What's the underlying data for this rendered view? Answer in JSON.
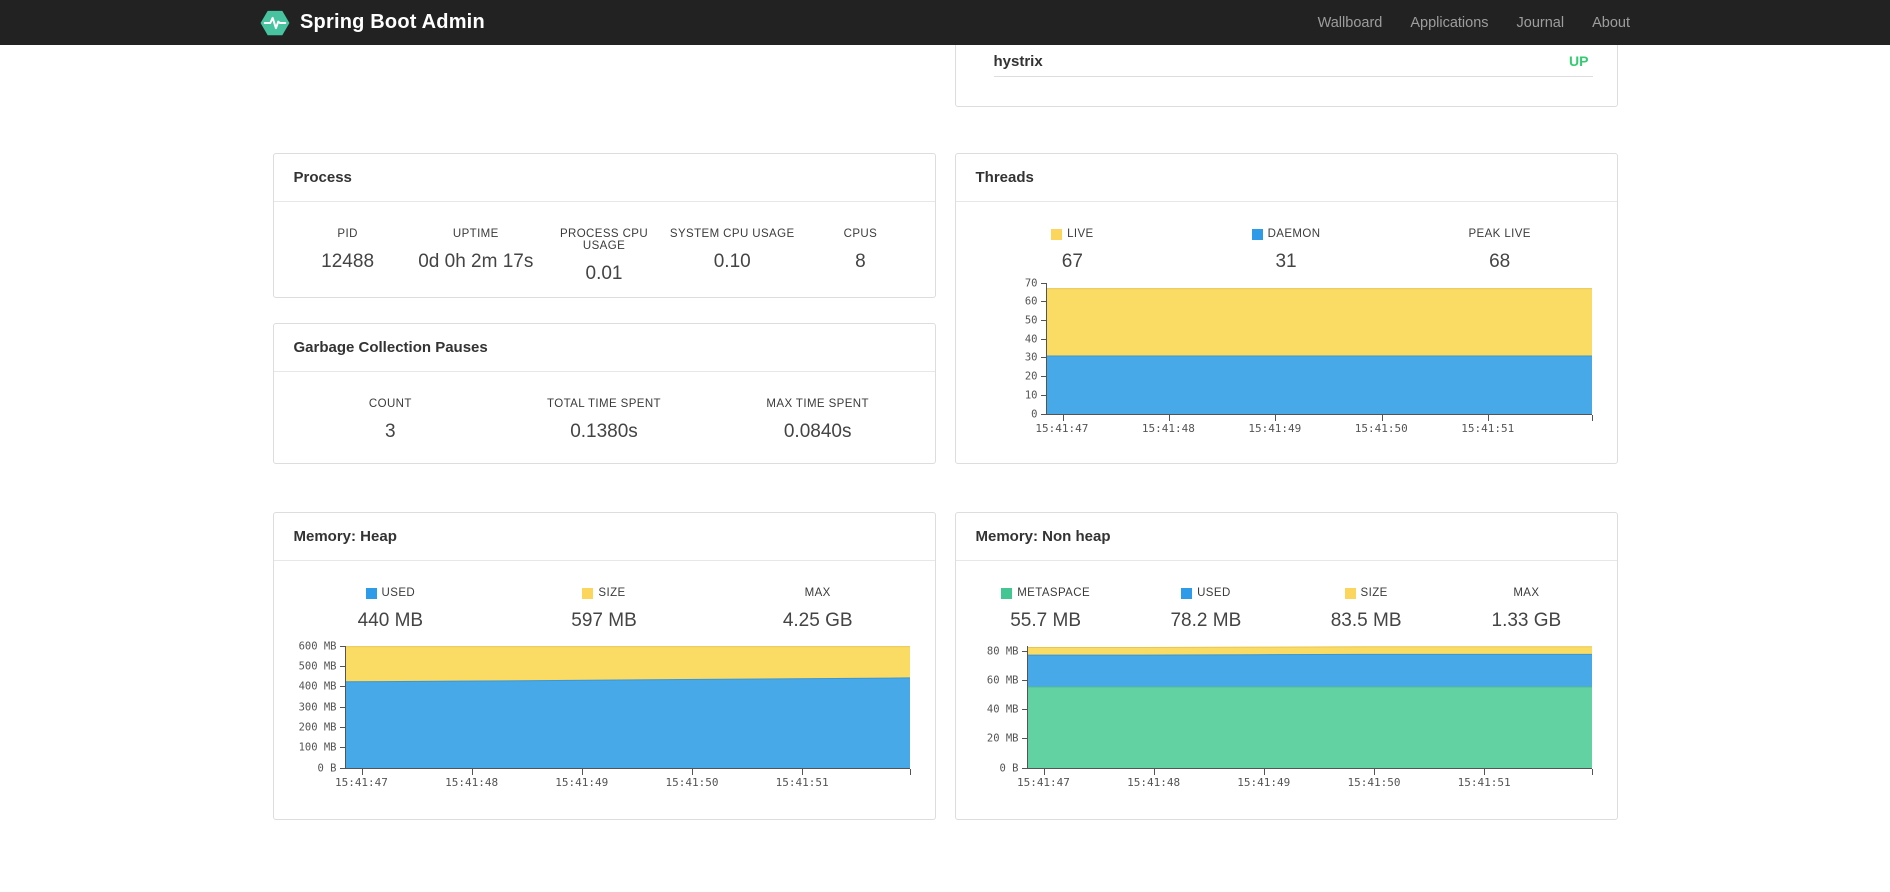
{
  "colors": {
    "brand-green": "#47c3a0",
    "navbar-bg": "#222222",
    "navbar-link": "#9d9d9d",
    "status-up-green": "#32cd70",
    "card-border": "#dddddd",
    "axis": "#545454",
    "chart-yellow": "#fadb63",
    "chart-blue": "#47a9e8",
    "chart-green": "#62d2a3"
  },
  "navbar": {
    "brand": "Spring Boot Admin",
    "logo_icon": "pulse-hexagon-icon",
    "links": [
      {
        "label": "Wallboard"
      },
      {
        "label": "Applications"
      },
      {
        "label": "Journal"
      },
      {
        "label": "About"
      }
    ]
  },
  "status_card": {
    "application": "hystrix",
    "status": "UP"
  },
  "cards": {
    "process": {
      "title": "Process",
      "metrics": [
        {
          "label": "PID",
          "value": "12488"
        },
        {
          "label": "UPTIME",
          "value": "0d 0h 2m 17s"
        },
        {
          "label": "PROCESS CPU USAGE",
          "value": "0.01"
        },
        {
          "label": "SYSTEM CPU USAGE",
          "value": "0.10"
        },
        {
          "label": "CPUS",
          "value": "8"
        }
      ]
    },
    "gc": {
      "title": "Garbage Collection Pauses",
      "metrics": [
        {
          "label": "COUNT",
          "value": "3"
        },
        {
          "label": "TOTAL TIME SPENT",
          "value": "0.1380s"
        },
        {
          "label": "MAX TIME SPENT",
          "value": "0.0840s"
        }
      ]
    },
    "threads": {
      "title": "Threads",
      "metrics": [
        {
          "label": "LIVE",
          "value": "67",
          "swatch": "#fbd55c"
        },
        {
          "label": "DAEMON",
          "value": "31",
          "swatch": "#2d9be8"
        },
        {
          "label": "PEAK LIVE",
          "value": "68"
        }
      ]
    },
    "heap": {
      "title": "Memory: Heap",
      "metrics": [
        {
          "label": "USED",
          "value": "440 MB",
          "swatch": "#2d9be8"
        },
        {
          "label": "SIZE",
          "value": "597 MB",
          "swatch": "#fbd55c"
        },
        {
          "label": "MAX",
          "value": "4.25 GB"
        }
      ]
    },
    "nonheap": {
      "title": "Memory: Non heap",
      "metrics": [
        {
          "label": "METASPACE",
          "value": "55.7 MB",
          "swatch": "#43c692"
        },
        {
          "label": "USED",
          "value": "78.2 MB",
          "swatch": "#2d9be8"
        },
        {
          "label": "SIZE",
          "value": "83.5 MB",
          "swatch": "#fbd55c"
        },
        {
          "label": "MAX",
          "value": "1.33 GB"
        }
      ]
    }
  },
  "chart_data": [
    {
      "type": "area",
      "title": "Threads",
      "xlabel": "",
      "ylabel": "",
      "grid": false,
      "legend_position": "top",
      "x": [
        "15:41:47",
        "15:41:48",
        "15:41:49",
        "15:41:50",
        "15:41:51"
      ],
      "x_start": 0.03,
      "x_step": 0.195,
      "extra_x_ticks": [
        1.0
      ],
      "ylim": [
        0,
        70
      ],
      "yticks": [
        {
          "v": 0,
          "label": "0"
        },
        {
          "v": 10,
          "label": "10"
        },
        {
          "v": 20,
          "label": "20"
        },
        {
          "v": 30,
          "label": "30"
        },
        {
          "v": 40,
          "label": "40"
        },
        {
          "v": 50,
          "label": "50"
        },
        {
          "v": 60,
          "label": "60"
        },
        {
          "v": 70,
          "label": "70"
        }
      ],
      "series": [
        {
          "name": "LIVE",
          "color": "#fadb63",
          "stroke": "#e9c54e",
          "values": [
            67,
            67,
            67,
            67,
            67,
            67
          ]
        },
        {
          "name": "DAEMON",
          "color": "#47a9e8",
          "stroke": "#3c96d3",
          "values": [
            31,
            31,
            31,
            31,
            31,
            31
          ]
        }
      ]
    },
    {
      "type": "area",
      "title": "Memory: Heap",
      "xlabel": "",
      "ylabel": "",
      "grid": false,
      "legend_position": "top",
      "unit": "MB",
      "x": [
        "15:41:47",
        "15:41:48",
        "15:41:49",
        "15:41:50",
        "15:41:51"
      ],
      "x_start": 0.03,
      "x_step": 0.195,
      "extra_x_ticks": [
        1.0
      ],
      "ylim": [
        0,
        600
      ],
      "yticks": [
        {
          "v": 0,
          "label": "0 B"
        },
        {
          "v": 100,
          "label": "100 MB"
        },
        {
          "v": 200,
          "label": "200 MB"
        },
        {
          "v": 300,
          "label": "300 MB"
        },
        {
          "v": 400,
          "label": "400 MB"
        },
        {
          "v": 500,
          "label": "500 MB"
        },
        {
          "v": 600,
          "label": "600 MB"
        }
      ],
      "series": [
        {
          "name": "SIZE",
          "color": "#fadb63",
          "stroke": "#e9c54e",
          "values": [
            597,
            597,
            597,
            597,
            597,
            597
          ]
        },
        {
          "name": "USED",
          "color": "#47a9e8",
          "stroke": "#3c96d3",
          "values": [
            424,
            427,
            431,
            435,
            439,
            443
          ]
        }
      ]
    },
    {
      "type": "area",
      "title": "Memory: Non heap",
      "xlabel": "",
      "ylabel": "",
      "grid": false,
      "legend_position": "top",
      "unit": "MB",
      "x": [
        "15:41:47",
        "15:41:48",
        "15:41:49",
        "15:41:50",
        "15:41:51"
      ],
      "x_start": 0.03,
      "x_step": 0.195,
      "extra_x_ticks": [
        1.0
      ],
      "ylim": [
        0,
        84
      ],
      "yticks": [
        {
          "v": 0,
          "label": "0 B"
        },
        {
          "v": 20,
          "label": "20 MB"
        },
        {
          "v": 40,
          "label": "40 MB"
        },
        {
          "v": 60,
          "label": "60 MB"
        },
        {
          "v": 80,
          "label": "80 MB"
        }
      ],
      "series": [
        {
          "name": "SIZE",
          "color": "#fadb63",
          "stroke": "#e9c54e",
          "values": [
            83,
            83,
            83.2,
            83.5,
            83.5,
            83.5
          ]
        },
        {
          "name": "USED",
          "color": "#47a9e8",
          "stroke": "#3c96d3",
          "values": [
            77.7,
            77.7,
            78,
            78.2,
            78.2,
            78.2
          ]
        },
        {
          "name": "METASPACE",
          "color": "#62d2a3",
          "stroke": "#52bd90",
          "values": [
            55.8,
            55.8,
            55.8,
            55.8,
            55.8,
            55.8
          ]
        }
      ]
    }
  ]
}
